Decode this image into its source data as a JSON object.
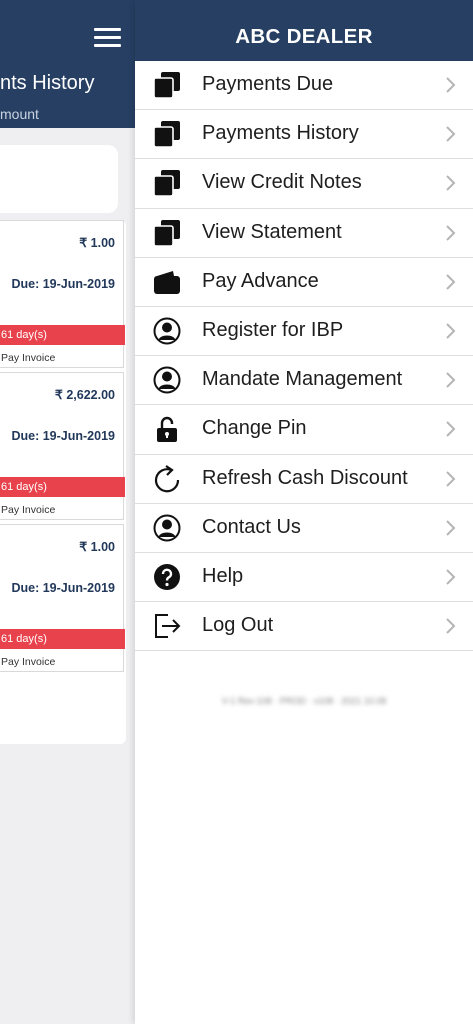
{
  "background": {
    "title": "nts History",
    "subtitle": "mount",
    "search_icon_glyph": "⌕",
    "cards": [
      {
        "amount": "₹ 1.00",
        "due": "Due: 19-Jun-2019",
        "overdue": "61 day(s)",
        "action": "Pay Invoice"
      },
      {
        "amount": "₹ 2,622.00",
        "due": "Due: 19-Jun-2019",
        "overdue": "61 day(s)",
        "action": "Pay Invoice"
      },
      {
        "amount": "₹ 1.00",
        "due": "Due: 19-Jun-2019",
        "overdue": "61 day(s)",
        "action": "Pay Invoice"
      }
    ]
  },
  "drawer": {
    "title": "ABC DEALER",
    "items": [
      {
        "label": "Payments Due",
        "icon": "copy-icon"
      },
      {
        "label": "Payments History",
        "icon": "copy-icon"
      },
      {
        "label": "View Credit Notes",
        "icon": "copy-icon"
      },
      {
        "label": "View Statement",
        "icon": "copy-icon"
      },
      {
        "label": "Pay Advance",
        "icon": "wallet-icon"
      },
      {
        "label": "Register for IBP",
        "icon": "user-circle-icon"
      },
      {
        "label": "Mandate Management",
        "icon": "user-circle-icon"
      },
      {
        "label": "Change Pin",
        "icon": "unlock-icon"
      },
      {
        "label": "Refresh Cash Discount",
        "icon": "refresh-icon"
      },
      {
        "label": "Contact Us",
        "icon": "user-circle-icon"
      },
      {
        "label": "Help",
        "icon": "help-icon"
      },
      {
        "label": "Log Out",
        "icon": "logout-icon"
      }
    ],
    "version": "V-1 Rev-108 · PROD · v108 · 2021 10.08"
  },
  "colors": {
    "header": "#263f63",
    "overdue": "#e8434d",
    "text_dark": "#1e1e1e",
    "amount_text": "#22385a"
  }
}
